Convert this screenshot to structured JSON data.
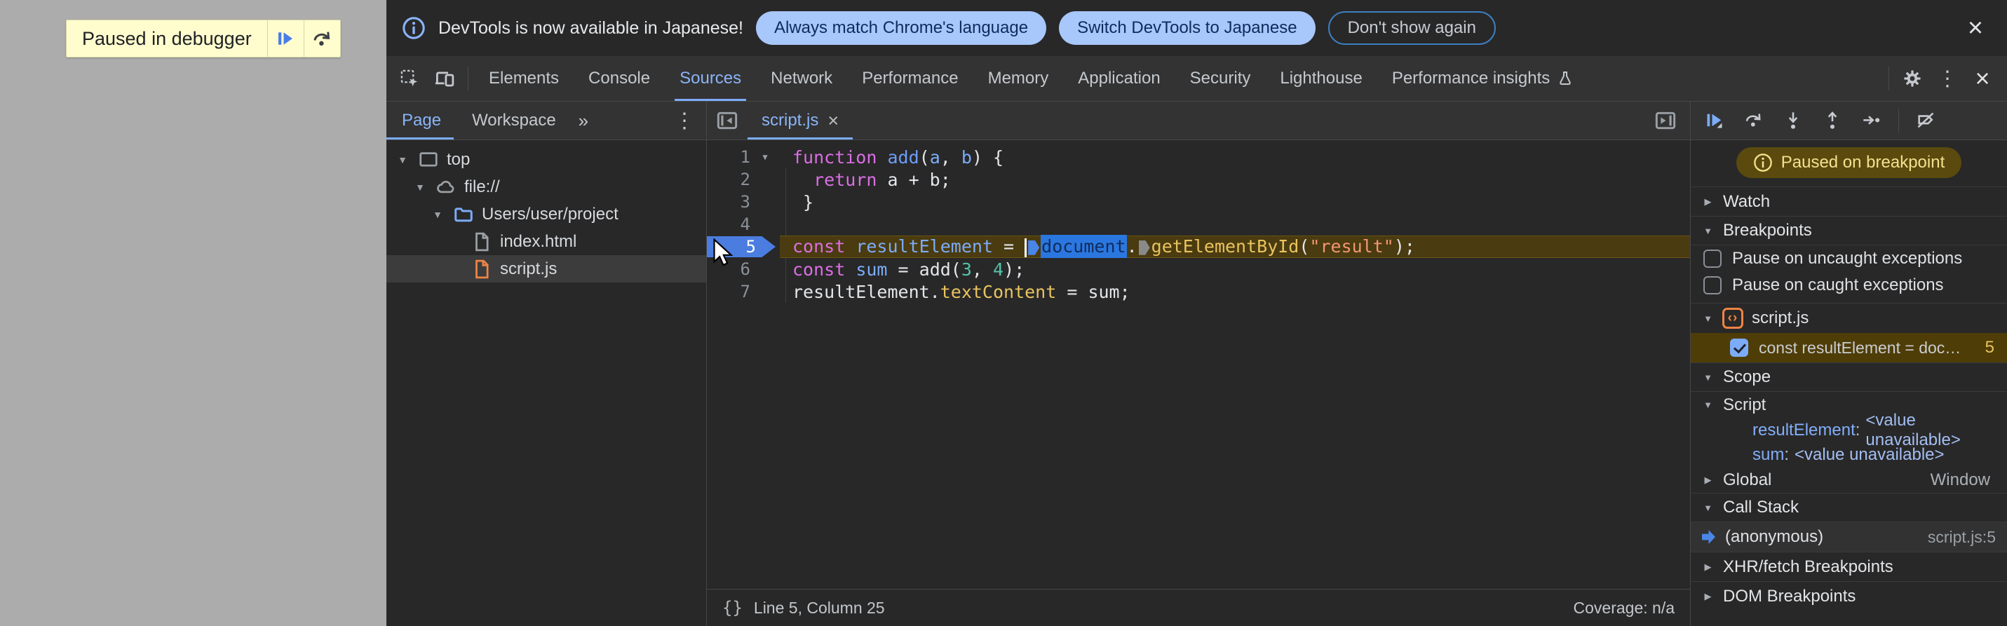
{
  "icons": {
    "kebab": "⋮",
    "more_tabs": "»",
    "close": "×",
    "tab_close": "×",
    "tri_down": "▼",
    "tri_right": "▶",
    "braces": "{}"
  },
  "colors": {
    "accent_blue": "#7cacf8",
    "selection_blue": "#2b77e0",
    "exec_line_bg": "#4a3b10",
    "paused_pill_bg": "#5a4a0e",
    "paused_pill_text": "#f2e18d",
    "breakpoint_entry_bg": "#4f3d07",
    "badge_bg": "#fffdce",
    "keyword_magenta": "#d96fe3",
    "property_yellow": "#e9c35f",
    "string_orange": "#f29672",
    "number_teal": "#53c2aa",
    "file_orange": "#ee8445"
  },
  "page": {
    "paused_badge": {
      "label": "Paused in debugger"
    }
  },
  "notification": {
    "message": "DevTools is now available in Japanese!",
    "actions": [
      {
        "label": "Always match Chrome's language"
      },
      {
        "label": "Switch DevTools to Japanese"
      },
      {
        "label": "Don't show again"
      }
    ]
  },
  "devtools": {
    "tabs": [
      {
        "label": "Elements"
      },
      {
        "label": "Console"
      },
      {
        "label": "Sources"
      },
      {
        "label": "Network"
      },
      {
        "label": "Performance"
      },
      {
        "label": "Memory"
      },
      {
        "label": "Application"
      },
      {
        "label": "Security"
      },
      {
        "label": "Lighthouse"
      },
      {
        "label": "Performance insights"
      }
    ],
    "active_tab": "Sources"
  },
  "navigator": {
    "tabs": [
      {
        "label": "Page"
      },
      {
        "label": "Workspace"
      }
    ],
    "active_tab": "Page",
    "tree": [
      {
        "label": "top"
      },
      {
        "label": "file://"
      },
      {
        "label": "Users/user/project"
      },
      {
        "label": "index.html"
      },
      {
        "label": "script.js"
      }
    ]
  },
  "editor": {
    "tab": {
      "label": "script.js"
    },
    "lines": [
      {
        "num": "1",
        "tokens": [
          {
            "t": "function"
          },
          {
            "t": " "
          },
          {
            "t": "add"
          },
          {
            "t": "("
          },
          {
            "t": "a"
          },
          {
            "t": ", "
          },
          {
            "t": "b"
          },
          {
            "t": ") {"
          }
        ]
      },
      {
        "num": "2",
        "tokens": [
          {
            "t": "  "
          },
          {
            "t": "return"
          },
          {
            "t": " a + b;"
          }
        ]
      },
      {
        "num": "3",
        "tokens": [
          {
            "t": " }"
          }
        ]
      },
      {
        "num": "4",
        "tokens": []
      },
      {
        "num": "5",
        "tokens": [
          {
            "t": "const"
          },
          {
            "t": " "
          },
          {
            "t": "resultElement"
          },
          {
            "t": " = "
          },
          {
            "t": "document"
          },
          {
            "t": "."
          },
          {
            "t": "getElementById"
          },
          {
            "t": "("
          },
          {
            "t": "\"result\""
          },
          {
            "t": ");"
          }
        ]
      },
      {
        "num": "6",
        "tokens": [
          {
            "t": "const"
          },
          {
            "t": " "
          },
          {
            "t": "sum"
          },
          {
            "t": " = add("
          },
          {
            "t": "3"
          },
          {
            "t": ", "
          },
          {
            "t": "4"
          },
          {
            "t": ");"
          }
        ]
      },
      {
        "num": "7",
        "tokens": [
          {
            "t": "resultElement."
          },
          {
            "t": "textContent"
          },
          {
            "t": " = sum;"
          }
        ]
      }
    ],
    "status": {
      "position": "Line 5, Column 25",
      "coverage": "Coverage: n/a"
    }
  },
  "debugger": {
    "paused_banner": "Paused on breakpoint",
    "watch": {
      "title": "Watch"
    },
    "breakpoints": {
      "title": "Breakpoints",
      "options": [
        {
          "label": "Pause on uncaught exceptions",
          "checked": false
        },
        {
          "label": "Pause on caught exceptions",
          "checked": false
        }
      ],
      "group": {
        "file": "script.js",
        "entry": {
          "snippet": "const resultElement = doc…",
          "line": "5",
          "checked": true
        }
      }
    },
    "scope": {
      "title": "Scope",
      "script_section": {
        "name": "Script",
        "vars": [
          {
            "name": "resultElement",
            "sep": ":",
            "value": "<value unavailable>"
          },
          {
            "name": "sum",
            "sep": ":",
            "value": "<value unavailable>"
          }
        ]
      },
      "global_section": {
        "name": "Global",
        "value": "Window"
      }
    },
    "call_stack": {
      "title": "Call Stack",
      "frame": {
        "name": "(anonymous)",
        "location": "script.js:5"
      }
    },
    "xhr": {
      "title": "XHR/fetch Breakpoints"
    },
    "dom": {
      "title": "DOM Breakpoints"
    }
  }
}
